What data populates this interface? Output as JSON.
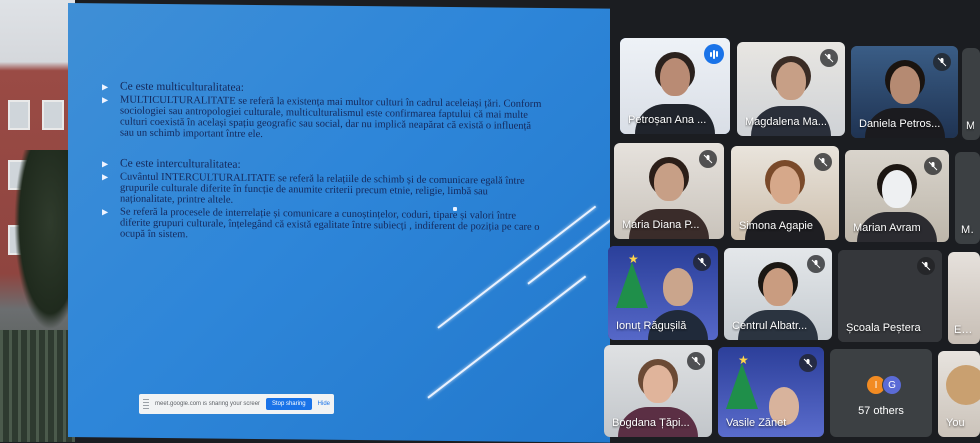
{
  "slide": {
    "items": [
      {
        "text": "Ce este multiculturalitatea:",
        "heading": true
      },
      {
        "text": "MULTICULTURALITATE  se referă la existența mai multor culturi în cadrul aceleiași țări. Conform sociologiei sau antropologiei culturale, multiculturalismul este confirmarea faptului că mai multe culturi coexistă în același spațiu geografic sau social, dar nu implică neapărat că există o influență sau un schimb important între ele.",
        "heading": false
      },
      {
        "text": "Ce este interculturalitatea:",
        "heading": true
      },
      {
        "text": "Cuvântul INTERCULTURALITATE se referă la relațiile de schimb și de comunicare egală între grupurile culturale  diferite în funcție de anumite criterii precum etnie, religie, limbă sau naționalitate, printre altele.",
        "heading": false
      },
      {
        "text": "Se referă la procesele de interrelație și comunicare a cunoștințelor, coduri, tipare și valori între diferite grupuri culturale, înțelegând că există egalitate între subiecți , indiferent de poziția pe care o ocupă în sistem.",
        "heading": false
      }
    ],
    "share_bar": {
      "message": "meet.google.com is sharing your screen.",
      "stop_label": "Stop sharing",
      "hide_label": "Hide"
    }
  },
  "participants": [
    {
      "name": "Petroșan Ana ...",
      "status": "speaking"
    },
    {
      "name": "Magdalena Ma...",
      "status": "muted"
    },
    {
      "name": "Daniela Petros...",
      "status": "muted"
    },
    {
      "name": "Maria Diana P...",
      "status": "muted"
    },
    {
      "name": "Simona Agapie",
      "status": "muted"
    },
    {
      "name": "Marian Avram",
      "status": "muted"
    },
    {
      "name": "Ionuț Răgușilă",
      "status": "muted"
    },
    {
      "name": "Centrul Albatr...",
      "status": "muted"
    },
    {
      "name": "Școala Peștera",
      "status": "muted"
    },
    {
      "name": "Bogdana Țăpi...",
      "status": "muted"
    },
    {
      "name": "Vasile Zănet",
      "status": "muted"
    }
  ],
  "partial_names": [
    "Ma",
    "Ma",
    "Elen",
    "You"
  ],
  "others": {
    "count_label": "57 others",
    "avatars": [
      "I",
      "G"
    ],
    "avatar_colors": [
      "#f28b22",
      "#5b6bd6"
    ]
  },
  "colors": {
    "accent": "#1a73e8",
    "slide_blue": "#2e86d9",
    "tile": "#3c4043"
  }
}
